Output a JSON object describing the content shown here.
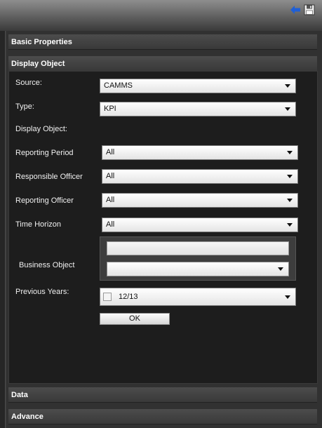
{
  "toolbar": {
    "back_icon": "back-arrow-icon",
    "save_icon": "save-disk-icon"
  },
  "sections": {
    "basic_properties": "Basic Properties",
    "display_object": "Display Object",
    "data": "Data",
    "advance": "Advance"
  },
  "form": {
    "source": {
      "label": "Source:",
      "value": "CAMMS"
    },
    "type": {
      "label": "Type:",
      "value": "KPI"
    },
    "display_object_label": "Display Object:",
    "reporting_period": {
      "label": "Reporting Period",
      "value": "All"
    },
    "responsible_officer": {
      "label": "Responsible Officer",
      "value": "All"
    },
    "reporting_officer": {
      "label": "Reporting Officer",
      "value": "All"
    },
    "time_horizon": {
      "label": "Time Horizon",
      "value": "All"
    },
    "business_object": {
      "label": "Business Object",
      "text_value": "",
      "select_value": ""
    },
    "previous_years": {
      "label": "Previous Years:",
      "value": "12/13"
    },
    "ok_label": "OK"
  },
  "colors": {
    "accent_arrow": "#1f5fd6",
    "panel_bg": "#1d1d1d"
  }
}
